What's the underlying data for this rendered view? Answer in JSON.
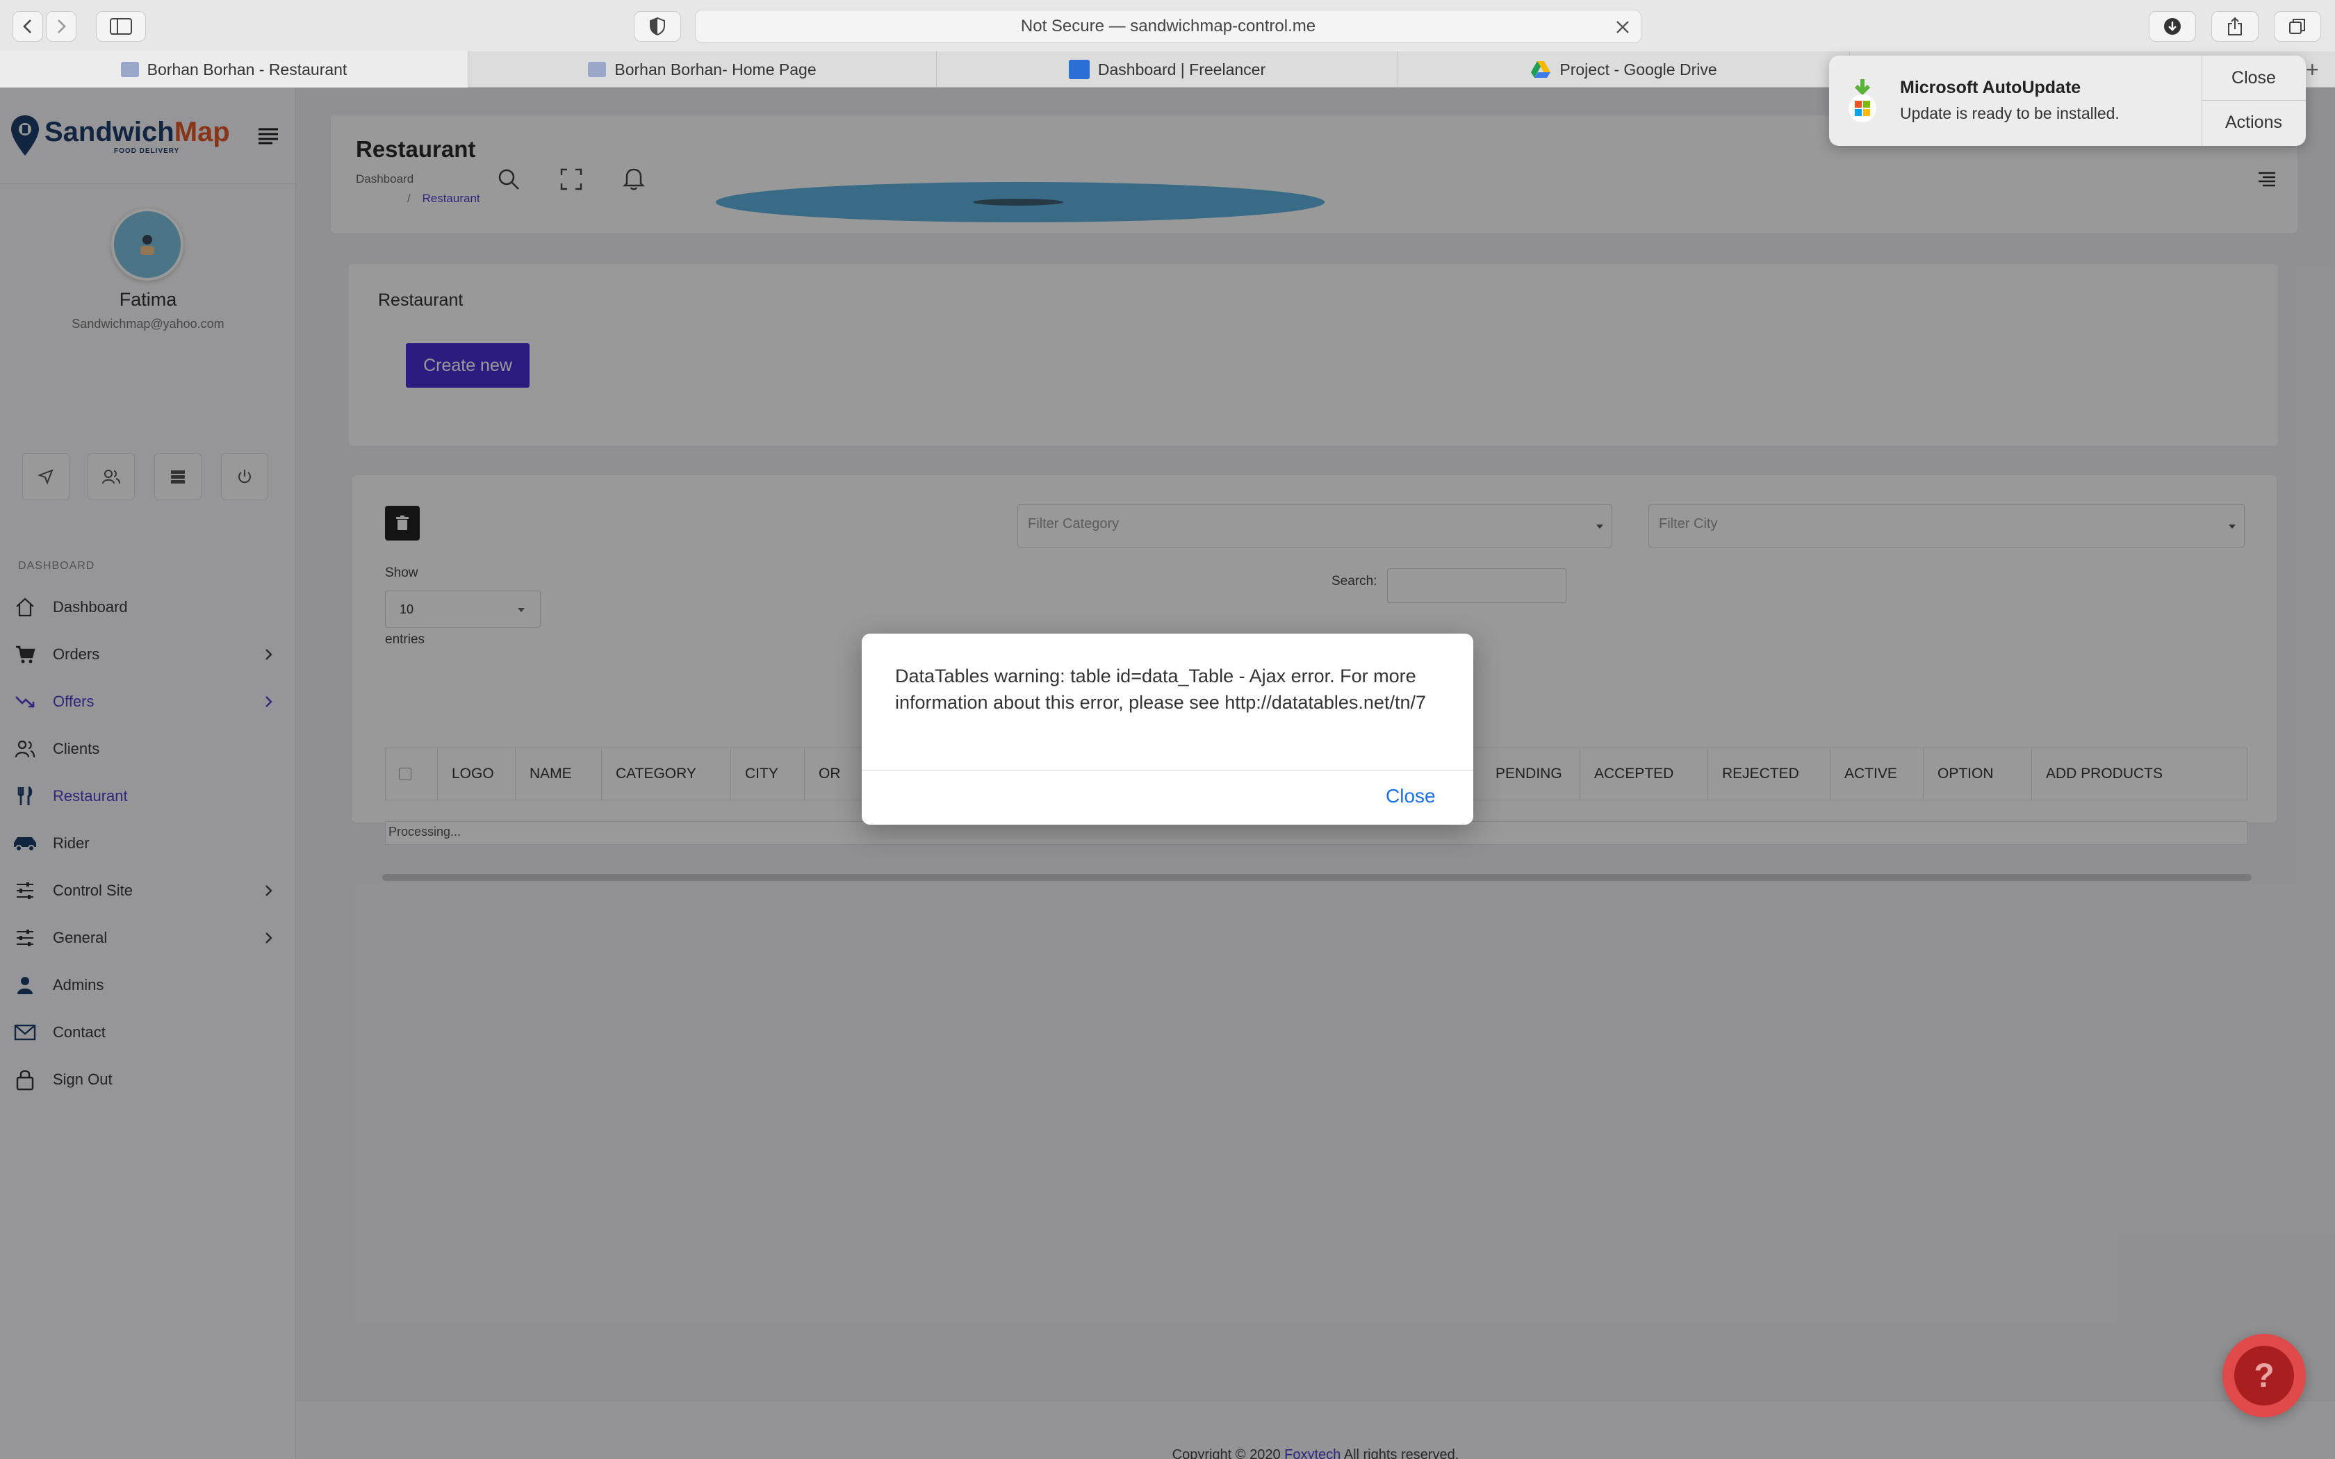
{
  "browser": {
    "url_text": "Not Secure — sandwichmap-control.me",
    "tabs": [
      {
        "label": "Borhan Borhan - Restaurant"
      },
      {
        "label": "Borhan Borhan- Home Page"
      },
      {
        "label": "Dashboard | Freelancer"
      },
      {
        "label": "Project - Google Drive"
      }
    ]
  },
  "brand": {
    "name_part1": "Sandwich",
    "name_part2": "Map",
    "tagline": "FOOD DELIVERY",
    "accent": "#e2572b",
    "primary": "#1e3f6b"
  },
  "profile": {
    "name": "Fatima",
    "email": "Sandwichmap@yahoo.com"
  },
  "sidebar": {
    "section_label": "DASHBOARD",
    "items": [
      {
        "label": "Dashboard",
        "icon": "home-icon"
      },
      {
        "label": "Orders",
        "icon": "cart-icon"
      },
      {
        "label": "Offers",
        "icon": "trend-down-icon"
      },
      {
        "label": "Clients",
        "icon": "users-icon"
      },
      {
        "label": "Restaurant",
        "icon": "fork-knife-icon"
      },
      {
        "label": "Rider",
        "icon": "car-icon"
      },
      {
        "label": "Control Site",
        "icon": "sliders-icon"
      },
      {
        "label": "General",
        "icon": "sliders-icon"
      },
      {
        "label": "Admins",
        "icon": "user-icon"
      },
      {
        "label": "Contact",
        "icon": "mail-icon"
      },
      {
        "label": "Sign Out",
        "icon": "lock-icon"
      }
    ]
  },
  "header": {
    "title": "Restaurant",
    "breadcrumb_root": "Dashboard",
    "breadcrumb_sep": "/",
    "breadcrumb_current": "Restaurant"
  },
  "create_card": {
    "title": "Restaurant",
    "create_button": "Create new",
    "button_color": "#4b2fd6"
  },
  "table_card": {
    "filter_category_placeholder": "Filter Category",
    "filter_city_placeholder": "Filter City",
    "show_label": "Show",
    "entries_value": "10",
    "entries_label": "entries",
    "search_label": "Search:",
    "columns": [
      "LOGO",
      "NAME",
      "CATEGORY",
      "CITY",
      "OR",
      "PENDING",
      "ACCEPTED",
      "REJECTED",
      "ACTIVE",
      "OPTION",
      "ADD PRODUCTS"
    ],
    "processing_text": "Processing..."
  },
  "dialog": {
    "message": "DataTables warning: table id=data_Table - Ajax error. For more information about this error, please see http://datatables.net/tn/7",
    "close_label": "Close"
  },
  "notification": {
    "title": "Microsoft AutoUpdate",
    "body": "Update is ready to be installed.",
    "close_label": "Close",
    "actions_label": "Actions"
  },
  "footer": {
    "prefix": "Copyright © 2020 ",
    "company": "Foxytech",
    "suffix": " All rights reserved."
  },
  "help_button": {
    "label": "?"
  }
}
